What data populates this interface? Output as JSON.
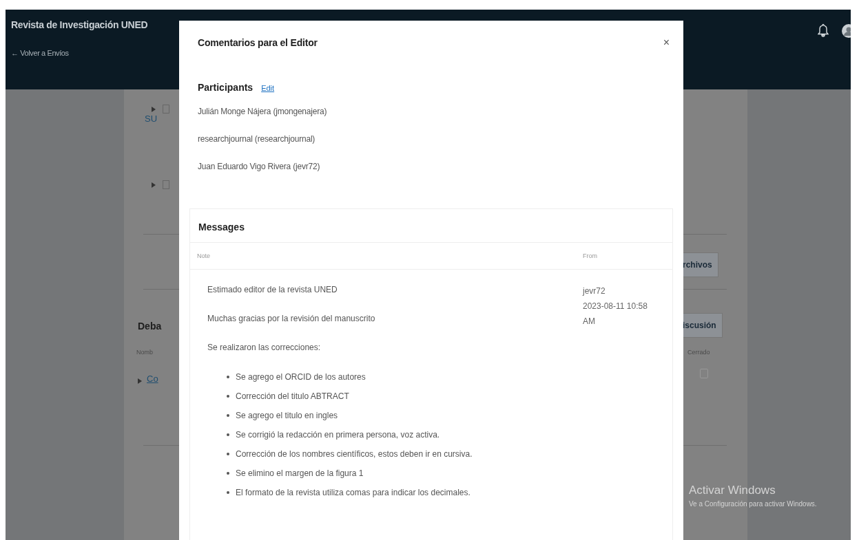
{
  "header": {
    "title": "Revista de Investigación UNED",
    "back_link": "← Volver a Envíos"
  },
  "background": {
    "upper_link": "SU",
    "files_button": "rchivos",
    "discussion_heading": "Deba",
    "column_1": "Nomb",
    "column_2": "Cerrado",
    "discussion_button": "iscusión",
    "discussion_row": {
      "link": "Co",
      "closed": false
    }
  },
  "modal": {
    "title": "Comentarios para el Editor",
    "close": "×",
    "participants_heading": "Participants",
    "edit_link": "Edit",
    "participants": [
      "Julián Monge Nájera (jmongenajera)",
      "researchjournal (researchjournal)",
      "Juan Eduardo Vigo Rivera (jevr72)"
    ],
    "messages": {
      "heading": "Messages",
      "columns": [
        "Note",
        "From"
      ],
      "rows": [
        {
          "paragraphs": [
            "Estimado editor de la revista UNED",
            "Muchas gracias por la revisión del manuscrito",
            "Se realizaron las correcciones:"
          ],
          "bullets": [
            "Se agrego el ORCID de los autores",
            "Corrección del titulo ABTRACT",
            "Se agrego el titulo en ingles",
            "Se corrigió la redacción en primera persona, voz activa.",
            "Corrección de los nombres científicos, estos deben ir en cursiva.",
            "Se elimino el margen de la figura 1",
            "El formato de la revista utiliza comas para indicar los decimales."
          ],
          "from": "jevr72",
          "date": "2023-08-11 10:58 AM"
        }
      ]
    }
  },
  "watermark": {
    "title": "Activar Windows",
    "subtitle": "Ve a Configuración para activar Windows."
  }
}
